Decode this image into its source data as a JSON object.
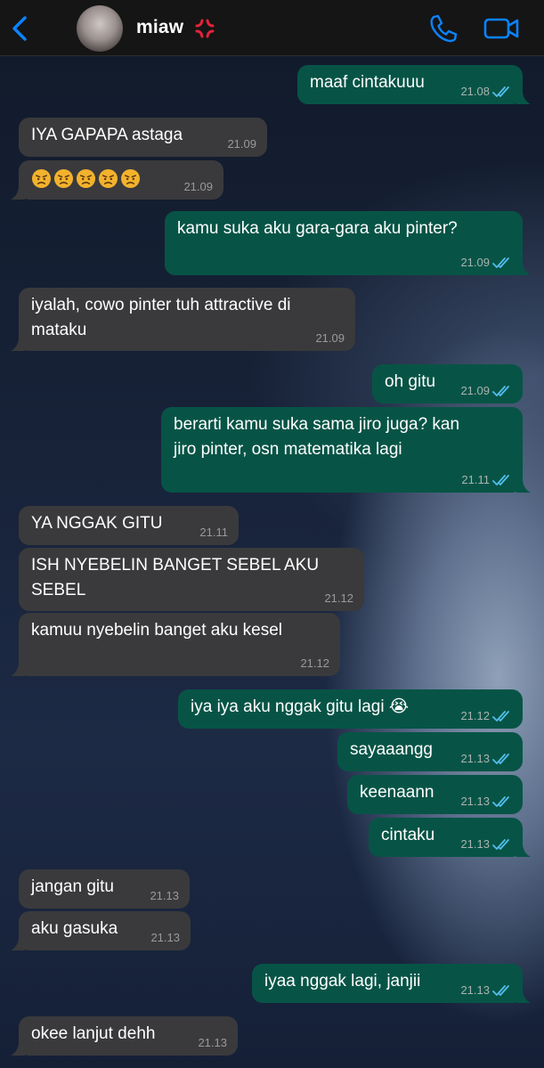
{
  "header": {
    "contact_name": "miaw",
    "name_emoji": "anger-symbol-icon",
    "actions": [
      "phone-icon",
      "video-call-icon"
    ],
    "accent_color": "#0a84ff"
  },
  "messages": [
    {
      "dir": "out",
      "text": "maaf cintakuuu",
      "time": "21.08",
      "read": true
    },
    {
      "dir": "in",
      "text": "IYA GAPAPA astaga",
      "time": "21.09"
    },
    {
      "dir": "in",
      "text": "😠😠😠😠😠",
      "time": "21.09"
    },
    {
      "dir": "out",
      "text": "kamu suka aku gara-gara aku pinter?",
      "time": "21.09",
      "read": true
    },
    {
      "dir": "in",
      "text_line1": "iyalah, cowo pinter tuh attractive di",
      "text_line2": "mataku",
      "time": "21.09"
    },
    {
      "dir": "out",
      "text": "oh gitu",
      "time": "21.09",
      "read": true
    },
    {
      "dir": "out",
      "text_line1": "berarti kamu suka sama jiro juga? kan",
      "text_line2": "jiro pinter, osn matematika lagi",
      "time": "21.11",
      "read": true
    },
    {
      "dir": "in",
      "text": "YA NGGAK GITU",
      "time": "21.11"
    },
    {
      "dir": "in",
      "text_line1": "ISH NYEBELIN BANGET SEBEL AKU",
      "text_line2": "SEBEL",
      "time": "21.12"
    },
    {
      "dir": "in",
      "text": "kamuu nyebelin banget aku kesel",
      "time": "21.12"
    },
    {
      "dir": "out",
      "text": "iya iya aku nggak gitu lagi 😭",
      "time": "21.12",
      "read": true
    },
    {
      "dir": "out",
      "text": "sayaaangg",
      "time": "21.13",
      "read": true
    },
    {
      "dir": "out",
      "text": "keenaann",
      "time": "21.13",
      "read": true
    },
    {
      "dir": "out",
      "text": "cintaku",
      "time": "21.13",
      "read": true
    },
    {
      "dir": "in",
      "text": "jangan gitu",
      "time": "21.13"
    },
    {
      "dir": "in",
      "text": "aku gasuka",
      "time": "21.13"
    },
    {
      "dir": "out",
      "text": "iyaa nggak lagi, janjii",
      "time": "21.13",
      "read": true
    },
    {
      "dir": "in",
      "text": "okee lanjut dehh",
      "time": "21.13"
    }
  ],
  "colors": {
    "incoming_bubble": "#3a3a3c",
    "outgoing_bubble": "#075446",
    "read_tick": "#53bdeb"
  }
}
